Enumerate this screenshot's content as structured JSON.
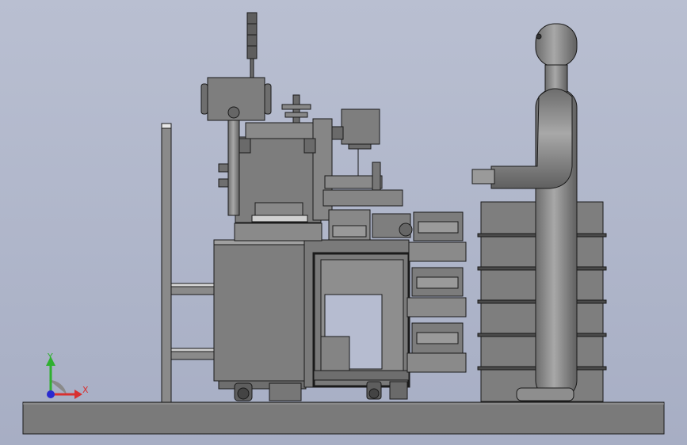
{
  "scene": {
    "background_top": "#b9bfd1",
    "background_bottom": "#a7aec4",
    "part_fill": "#7f7f7f",
    "part_light": "#a6a6a6",
    "part_dark": "#5a5a5a",
    "edge": "#1a1a1a"
  },
  "triad": {
    "y_label": "Y",
    "x_label": "X",
    "y_color": "#2fb02f",
    "x_color": "#d83030",
    "z_color": "#2a2ad0"
  }
}
